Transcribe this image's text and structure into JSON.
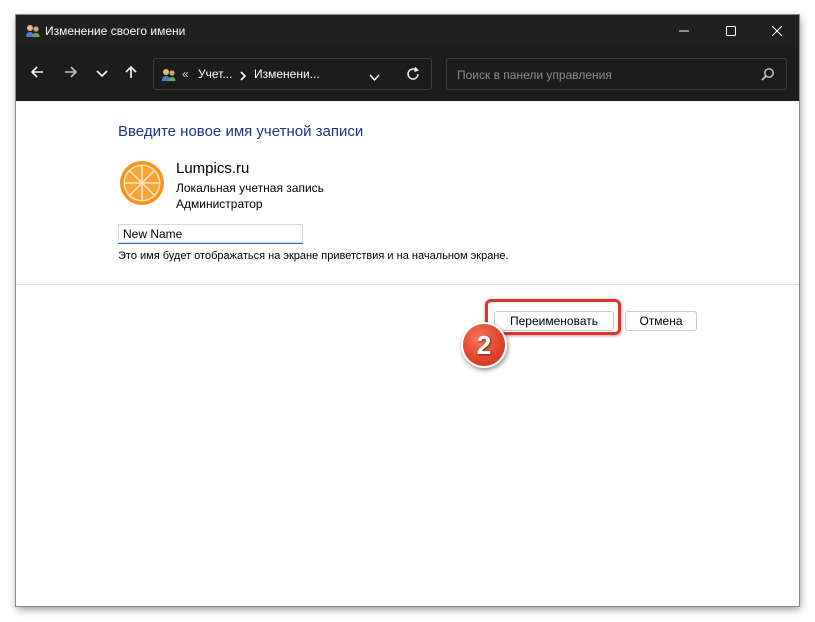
{
  "window": {
    "title": "Изменение своего имени"
  },
  "nav": {
    "breadcrumb_overflow": "«",
    "breadcrumb_1": "Учет...",
    "breadcrumb_2": "Изменени...",
    "search_placeholder": "Поиск в панели управления"
  },
  "content": {
    "heading": "Введите новое имя учетной записи",
    "account_name": "Lumpics.ru",
    "account_type": "Локальная учетная запись",
    "account_role": "Администратор",
    "name_input_value": "New Name",
    "hint": "Это имя будет отображаться на экране приветствия и на начальном экране.",
    "rename_button": "Переименовать",
    "cancel_button": "Отмена"
  },
  "annotation": {
    "step_number": "2",
    "highlight_color": "#e4322b"
  },
  "colors": {
    "titlebar": "#202020",
    "navbar": "#1c1c1c",
    "heading": "#1e3287",
    "avatar_orange": "#f7941d"
  },
  "icons": {
    "app": "users-control-panel-icon",
    "back": "arrow-left-icon",
    "forward": "arrow-right-icon",
    "recent": "chevron-down-icon",
    "up": "arrow-up-icon",
    "refresh": "refresh-icon",
    "search": "search-icon",
    "avatar": "orange-slice-avatar"
  }
}
